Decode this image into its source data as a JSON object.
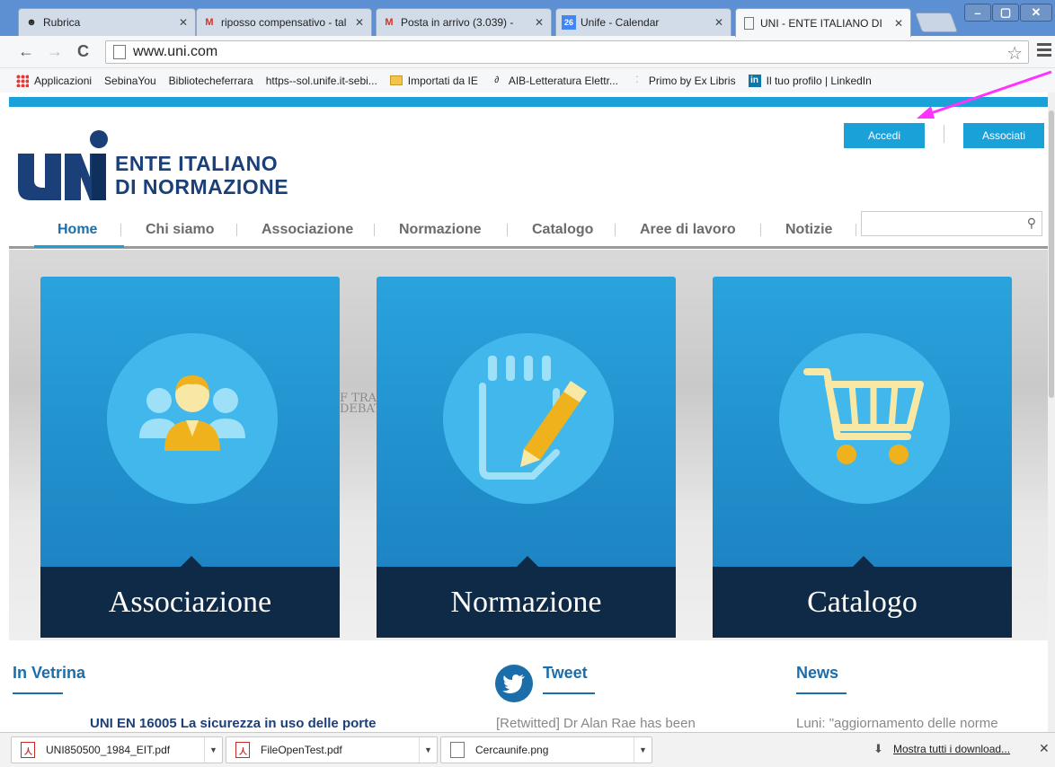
{
  "browser": {
    "tabs": [
      {
        "title": "Rubrica",
        "icon": "rubrica-icon"
      },
      {
        "title": "riposso compensativo - tal",
        "icon": "gmail-icon"
      },
      {
        "title": "Posta in arrivo (3.039) -",
        "icon": "gmail-icon"
      },
      {
        "title": "Unife - Calendar",
        "icon": "calendar-icon"
      },
      {
        "title": "UNI - ENTE ITALIANO DI",
        "icon": "page-icon"
      }
    ],
    "url": "www.uni.com",
    "bookmarks": [
      {
        "label": "Applicazioni",
        "icon": "apps-icon"
      },
      {
        "label": "SebinaYou",
        "icon": "page-icon"
      },
      {
        "label": "Bibliotecheferrara",
        "icon": "page-icon"
      },
      {
        "label": "https--sol.unife.it-sebi...",
        "icon": "page-icon"
      },
      {
        "label": "Importati da IE",
        "icon": "folder-icon"
      },
      {
        "label": "AIB-Letteratura Elettr...",
        "icon": "leaf-icon"
      },
      {
        "label": "Primo by Ex Libris",
        "icon": "dots-icon"
      },
      {
        "label": "Il tuo profilo | LinkedIn",
        "icon": "linkedin-icon"
      }
    ]
  },
  "site": {
    "logo_line1": "ENTE ITALIANO",
    "logo_line2": "DI NORMAZIONE",
    "login_label": "Accedi",
    "join_label": "Associati",
    "nav": [
      "Home",
      "Chi siamo",
      "Associazione",
      "Normazione",
      "Catalogo",
      "Aree di lavoro",
      "Notizie"
    ],
    "cards": [
      {
        "label": "Associazione",
        "icon": "people-icon"
      },
      {
        "label": "Normazione",
        "icon": "pencil-notepad-icon"
      },
      {
        "label": "Catalogo",
        "icon": "cart-icon"
      }
    ],
    "sections": {
      "vetrina": {
        "title": "In Vetrina",
        "snippet": "UNI EN 16005 La sicurezza in uso delle porte"
      },
      "tweet": {
        "title": "Tweet",
        "snippet": "[Retwitted] Dr Alan Rae has been"
      },
      "news": {
        "title": "News",
        "snippet": "Luni: \"aggiornamento delle norme"
      }
    },
    "hero_background_text": "F TRA\nDEBAT"
  },
  "downloads": {
    "items": [
      {
        "name": "UNI850500_1984_EIT.pdf",
        "icon": "pdf-icon"
      },
      {
        "name": "FileOpenTest.pdf",
        "icon": "pdf-icon"
      },
      {
        "name": "Cercaunife.png",
        "icon": "image-icon"
      }
    ],
    "show_all": "Mostra tutti i download..."
  },
  "colors": {
    "accent": "#1aa1d8",
    "brand_dark": "#1b3f78",
    "card_band": "#0f2a46",
    "annotation_arrow": "#ff33ff"
  }
}
